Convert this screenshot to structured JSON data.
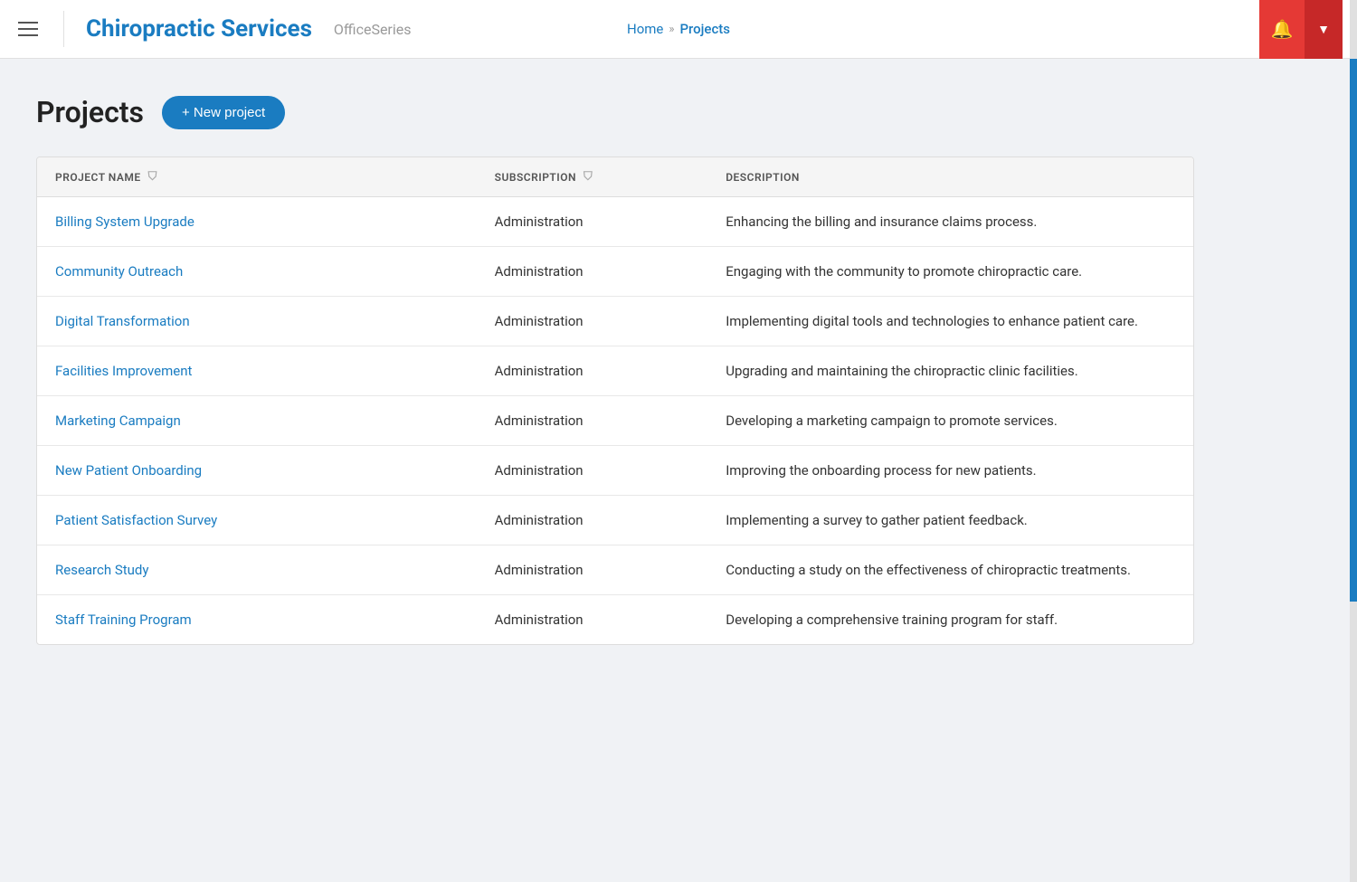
{
  "header": {
    "menu_icon": "hamburger-icon",
    "app_title": "Chiropractic Services",
    "app_subtitle": "OfficeSeries",
    "nav_home": "Home",
    "nav_separator": "»",
    "nav_current": "Projects",
    "bell_icon": "bell-icon",
    "dropdown_icon": "chevron-down-icon"
  },
  "page": {
    "title": "Projects",
    "new_project_button": "+ New project"
  },
  "table": {
    "columns": [
      {
        "id": "name",
        "label": "PROJECT NAME",
        "has_filter": true
      },
      {
        "id": "subscription",
        "label": "SUBSCRIPTION",
        "has_filter": true
      },
      {
        "id": "description",
        "label": "DESCRIPTION",
        "has_filter": false
      }
    ],
    "rows": [
      {
        "name": "Billing System Upgrade",
        "subscription": "Administration",
        "description": "Enhancing the billing and insurance claims process."
      },
      {
        "name": "Community Outreach",
        "subscription": "Administration",
        "description": "Engaging with the community to promote chiropractic care."
      },
      {
        "name": "Digital Transformation",
        "subscription": "Administration",
        "description": "Implementing digital tools and technologies to enhance patient care."
      },
      {
        "name": "Facilities Improvement",
        "subscription": "Administration",
        "description": "Upgrading and maintaining the chiropractic clinic facilities."
      },
      {
        "name": "Marketing Campaign",
        "subscription": "Administration",
        "description": "Developing a marketing campaign to promote services."
      },
      {
        "name": "New Patient Onboarding",
        "subscription": "Administration",
        "description": "Improving the onboarding process for new patients."
      },
      {
        "name": "Patient Satisfaction Survey",
        "subscription": "Administration",
        "description": "Implementing a survey to gather patient feedback."
      },
      {
        "name": "Research Study",
        "subscription": "Administration",
        "description": "Conducting a study on the effectiveness of chiropractic treatments."
      },
      {
        "name": "Staff Training Program",
        "subscription": "Administration",
        "description": "Developing a comprehensive training program for staff."
      }
    ]
  }
}
